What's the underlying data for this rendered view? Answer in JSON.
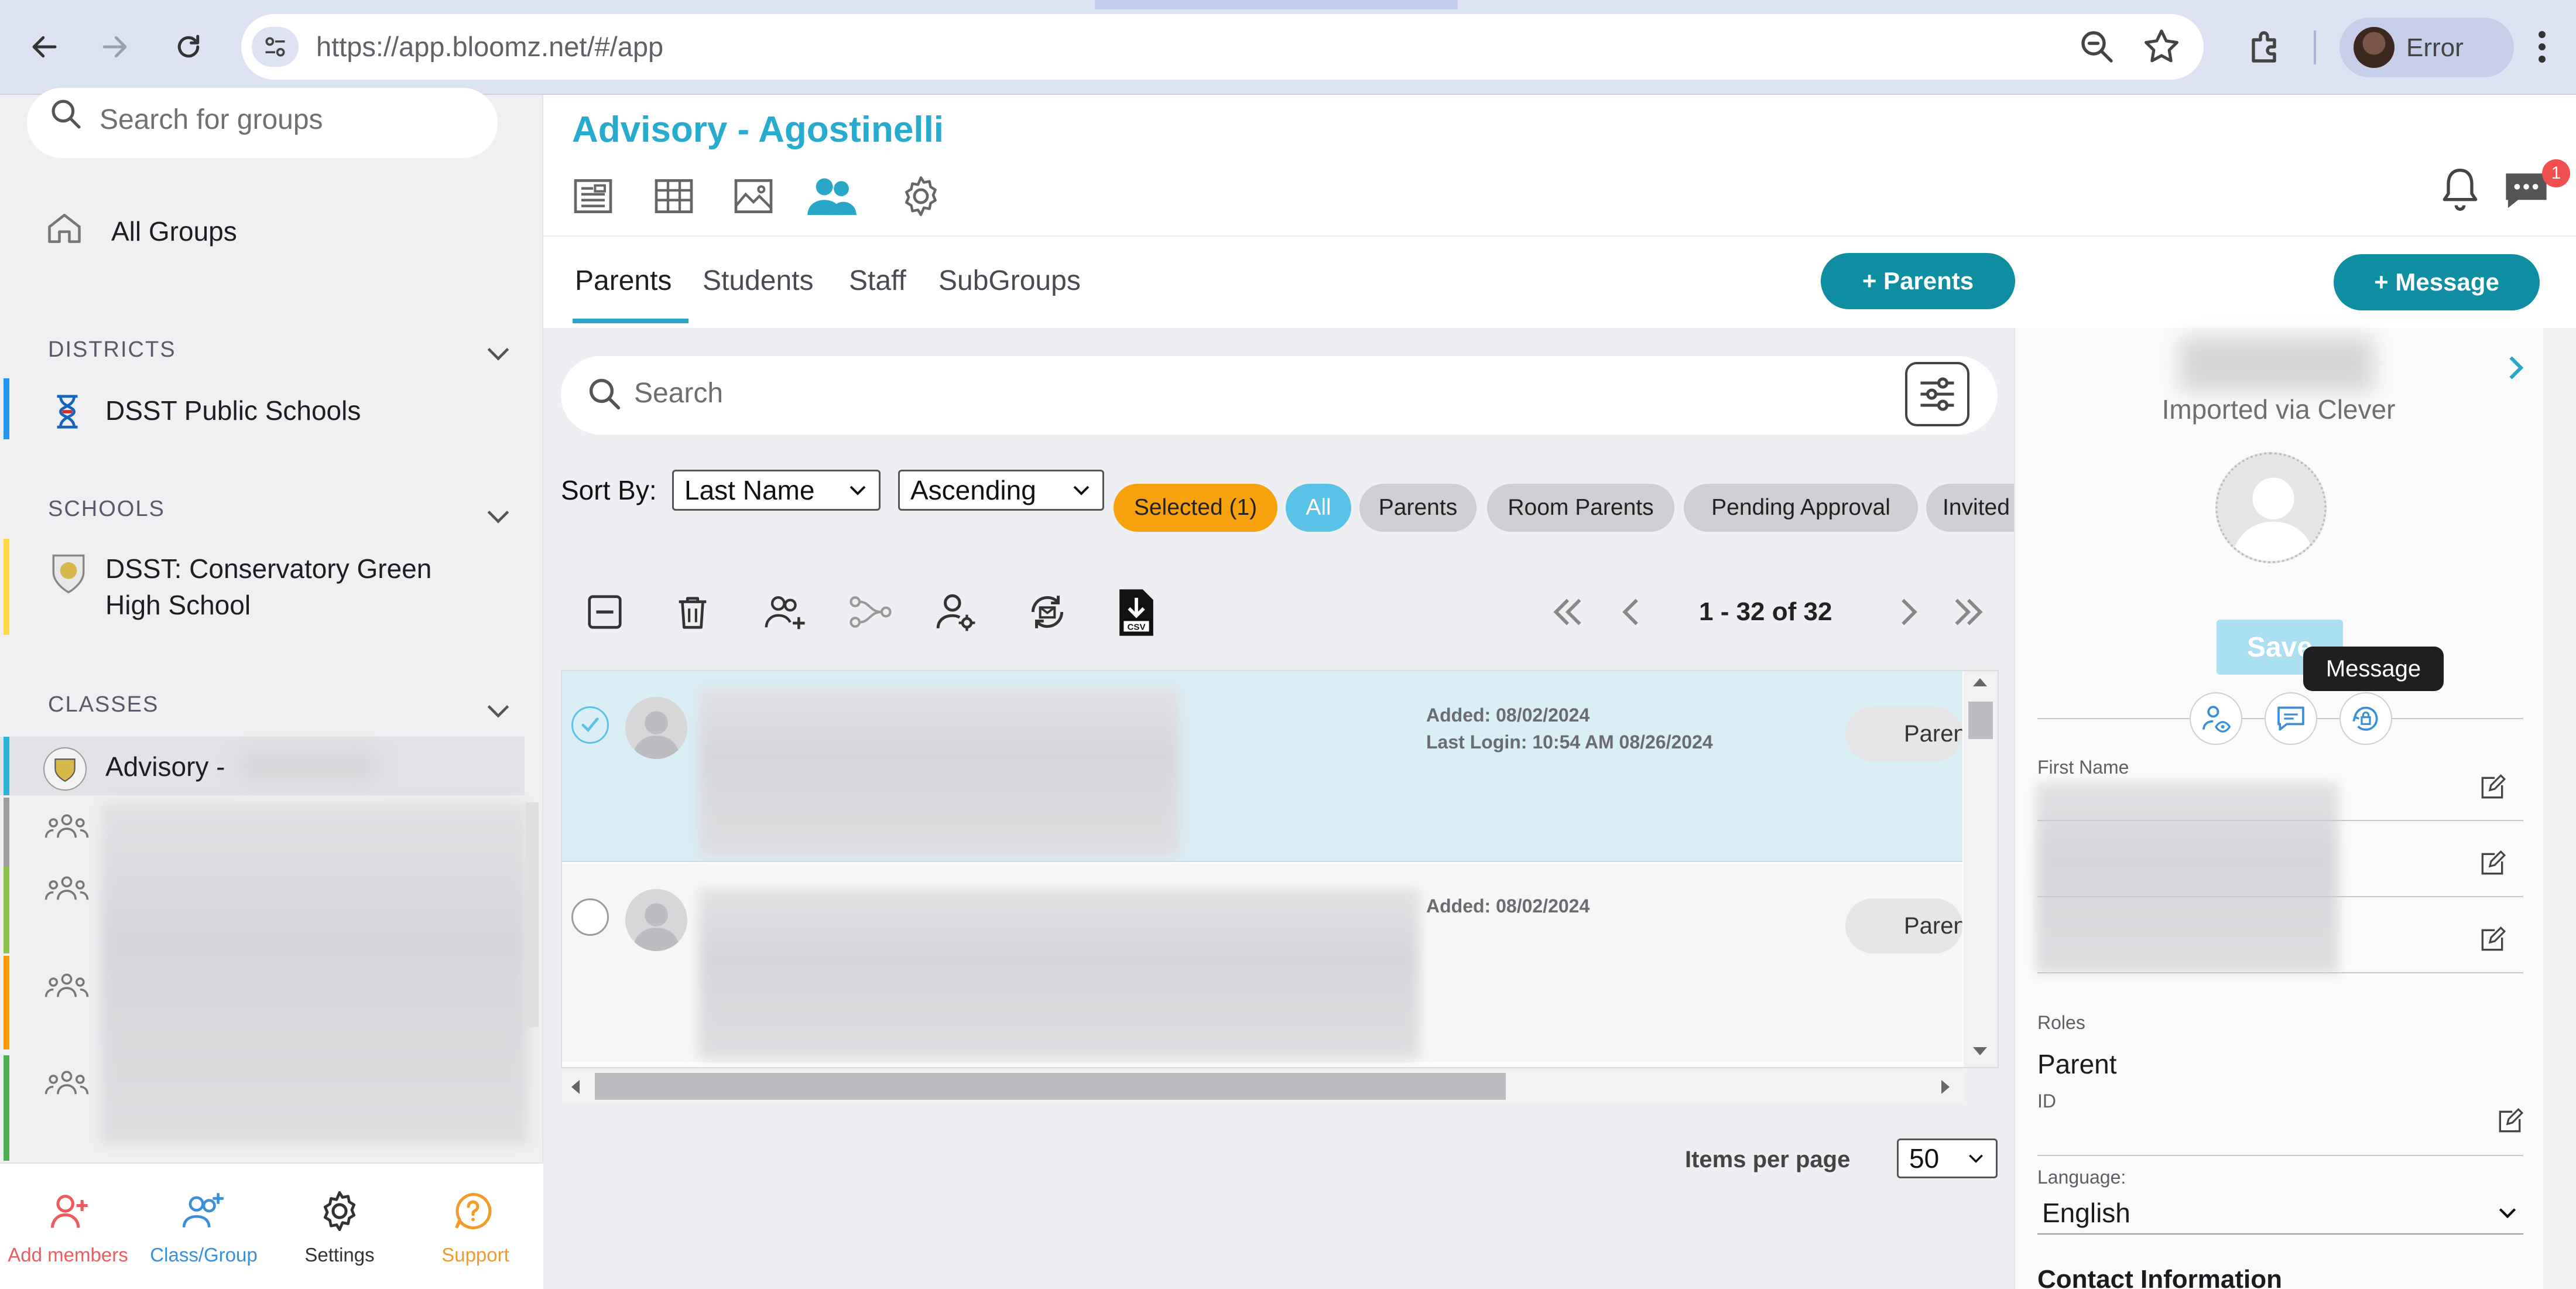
{
  "browser": {
    "url": "https://app.bloomz.net/#/app",
    "profile_label": "Error"
  },
  "sidebar": {
    "search_placeholder": "Search for groups",
    "all_groups": "All Groups",
    "districts_header": "DISTRICTS",
    "district_item": "DSST Public Schools",
    "schools_header": "SCHOOLS",
    "school_item_line1": "DSST: Conservatory Green",
    "school_item_line2": "High School",
    "classes_header": "CLASSES",
    "class_item_selected": "Advisory -",
    "bottom_nav": {
      "add_members": "Add members",
      "class_group": "Class/Group",
      "settings": "Settings",
      "support": "Support"
    }
  },
  "header": {
    "title": "Advisory - Agostinelli",
    "notification_count": "1"
  },
  "tabs": [
    "Parents",
    "Students",
    "Staff",
    "SubGroups"
  ],
  "actions": {
    "add_parents": "+ Parents",
    "add_message": "+ Message"
  },
  "list": {
    "search_placeholder": "Search",
    "sort_by_label": "Sort By:",
    "sort_field": "Last Name",
    "sort_order": "Ascending",
    "chips": {
      "selected": "Selected (1)",
      "all": "All",
      "parents": "Parents",
      "room_parents": "Room Parents",
      "pending_approval": "Pending Approval",
      "invited": "Invited"
    },
    "pagination": "1 - 32 of 32",
    "items_per_page_label": "Items per page",
    "items_per_page_value": "50",
    "rows": [
      {
        "added": "Added: 08/02/2024",
        "last_login": "Last Login: 10:54 AM 08/26/2024",
        "role": "Parent"
      },
      {
        "added": "Added: 08/02/2024",
        "role": "Parent"
      }
    ],
    "csv_label": "CSV"
  },
  "detail": {
    "imported_via": "Imported via Clever",
    "save_label": "Save",
    "tooltip": "Message",
    "first_name_label": "First Name",
    "roles_label": "Roles",
    "roles_value": "Parent",
    "id_label": "ID",
    "language_label": "Language:",
    "language_value": "English",
    "contact_info_header": "Contact Information"
  },
  "colors": {
    "brand_teal": "#0e8ea0",
    "title_blue": "#27acd0",
    "selected_chip": "#f7a20c",
    "all_chip": "#5ac2e6",
    "selected_row": "#daeef6"
  }
}
